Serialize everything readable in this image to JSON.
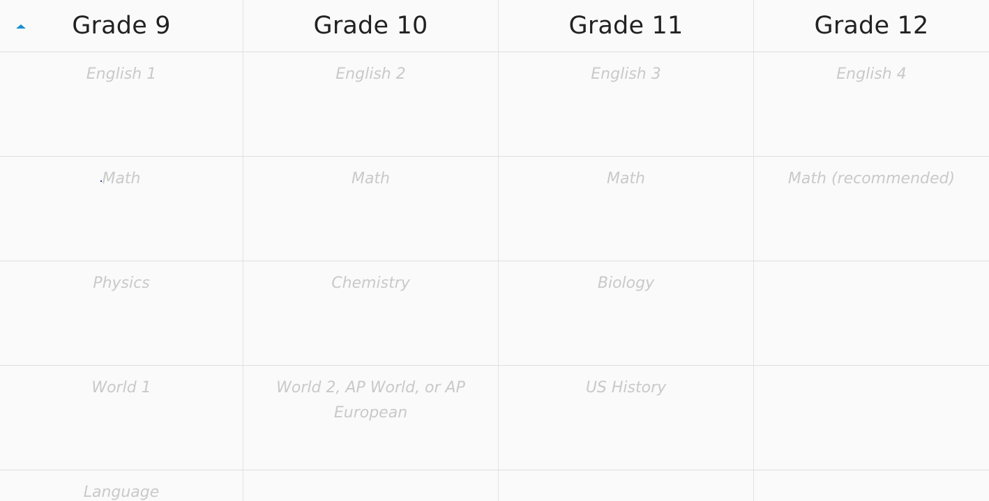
{
  "header": {
    "columns": [
      {
        "label": "Grade 9",
        "sorted": "ascending"
      },
      {
        "label": "Grade 10"
      },
      {
        "label": "Grade 11"
      },
      {
        "label": "Grade 12"
      }
    ],
    "sort_icon": "caret-up-icon",
    "accent_color": "#1a8fd0"
  },
  "rows": [
    {
      "cells": [
        "English 1",
        "English 2",
        "English 3",
        "English 4"
      ]
    },
    {
      "cells": [
        "Math",
        "Math",
        "Math",
        "Math (recommended)"
      ]
    },
    {
      "cells": [
        "Physics",
        "Chemistry",
        "Biology",
        ""
      ]
    },
    {
      "cells": [
        "World 1",
        "World 2, AP World, or AP European",
        "US History",
        ""
      ]
    },
    {
      "cells": [
        "Language",
        "",
        "",
        ""
      ]
    }
  ]
}
